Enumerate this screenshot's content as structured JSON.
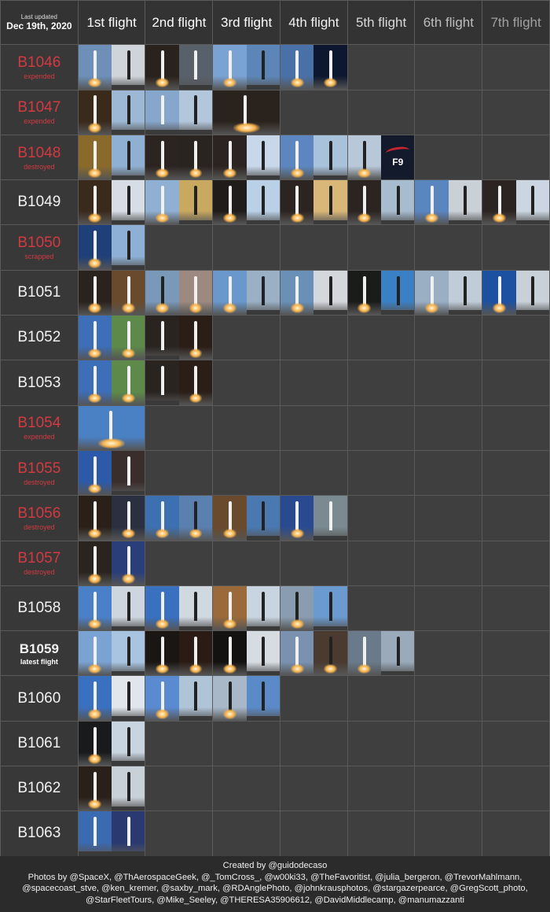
{
  "header": {
    "last_updated_label": "Last updated",
    "last_updated_date": "Dec 19th, 2020",
    "columns": [
      "1st flight",
      "2nd flight",
      "3rd flight",
      "4th flight",
      "5th flight",
      "6th flight",
      "7th flight"
    ],
    "column_colors": [
      "#ffffff",
      "#ffffff",
      "#ffffff",
      "#f0f0f0",
      "#d8d8d8",
      "#bdbdbd",
      "#a0a0a0"
    ]
  },
  "colors": {
    "dead_booster": "#d23a42",
    "active_booster": "#f2f2f2",
    "background": "#2b2b2b",
    "grid_line": "#5a5a5a",
    "empty_cell": "#3f3f3f"
  },
  "boosters": [
    {
      "name": "B1046",
      "status": "expended",
      "state": "dead",
      "flights": [
        [
          "#6d8fb8:light:plume",
          "#cfd4da:dark"
        ],
        [
          "#2a221c:light:plume",
          "#58606a:light"
        ],
        [
          "#7aa2d2:light:plume",
          "#5d86b8:dark"
        ],
        [
          "#4a70a8:light:plume",
          "#0d1830:light:plume"
        ]
      ]
    },
    {
      "name": "B1047",
      "status": "expended",
      "state": "dead",
      "flights": [
        [
          "#3a2a1c:light:plume",
          "#9db8d4:dark"
        ],
        [
          "#86a6cc:light",
          "#b3c7dc:dark"
        ],
        [
          "#2a221c:light:plume"
        ]
      ]
    },
    {
      "name": "B1048",
      "status": "destroyed",
      "state": "dead",
      "flights": [
        [
          "#8a6a2a:light:plume",
          "#8fb0d2:dark"
        ],
        [
          "#2c2420:light:plume",
          "#2a2420:light:plume"
        ],
        [
          "#2c2420:light:plume",
          "#c8d8ea:dark"
        ],
        [
          "#5d86c0:light:plume",
          "#a9c2dc:dark"
        ],
        [
          "#b8c8d8:dark:plume",
          "F9"
        ]
      ]
    },
    {
      "name": "B1049",
      "status": "",
      "state": "active",
      "flights": [
        [
          "#3a2a1c:light:plume",
          "#d6dde4:dark"
        ],
        [
          "#8fb0d2:light:plume",
          "#c9a860:dark"
        ],
        [
          "#201c1a:light:plume",
          "#b9d0e6:dark"
        ],
        [
          "#2c2420:light:plume",
          "#d9b778:dark"
        ],
        [
          "#2c2420:light:plume",
          "#a8bcd0:dark"
        ],
        [
          "#5a86c0:light:plume",
          "#c9d0d6:dark"
        ],
        [
          "#2c2420:light:plume",
          "#cbd6e2:dark"
        ]
      ]
    },
    {
      "name": "B1050",
      "status": "scrapped",
      "state": "dead",
      "flights": [
        [
          "#1f3f78:light:plume",
          "#8eb0d4:dark"
        ]
      ]
    },
    {
      "name": "B1051",
      "status": "",
      "state": "active",
      "flights": [
        [
          "#2a221c:light:plume",
          "#6a4a2c:light:plume"
        ],
        [
          "#7a98b8:dark:plume",
          "#9c8a80:light:plume"
        ],
        [
          "#6a98cc:light:plume",
          "#9ab0c4:dark"
        ],
        [
          "#6a90b8:light:plume",
          "#d4d8dc:dark"
        ],
        [
          "#1a1c1a:light:plume",
          "#3a80c4:dark"
        ],
        [
          "#9aaec4:light:plume",
          "#c0ccd8:dark"
        ],
        [
          "#1c50a0:light:plume",
          "#c8d0d8:dark"
        ]
      ]
    },
    {
      "name": "B1052",
      "status": "",
      "state": "active",
      "flights": [
        [
          "#3d6eb8:light:plume",
          "#5d8a4a:light:plume"
        ],
        [
          "#2a2420:light",
          "#2a1e16:light:plume"
        ]
      ]
    },
    {
      "name": "B1053",
      "status": "",
      "state": "active",
      "flights": [
        [
          "#3d6eb8:light:plume",
          "#5d8a4a:light:plume"
        ],
        [
          "#2a2420:light",
          "#2a1e16:light:plume"
        ]
      ]
    },
    {
      "name": "B1054",
      "status": "expended",
      "state": "dead",
      "flights": [
        [
          "#4a80c4:light:plume"
        ]
      ]
    },
    {
      "name": "B1055",
      "status": "destroyed",
      "state": "dead",
      "flights": [
        [
          "#2d5aa8:light:plume",
          "#3a2e2c:light"
        ]
      ]
    },
    {
      "name": "B1056",
      "status": "destroyed",
      "state": "dead",
      "flights": [
        [
          "#2a2018:light:plume",
          "#2a3040:light:plume"
        ],
        [
          "#3d70b0:light:plume",
          "#5a80b0:dark:plume"
        ],
        [
          "#6a4a2c:light:plume",
          "#4a78b0:dark"
        ],
        [
          "#2a4a90:light:plume",
          "#7a8a90:light"
        ]
      ]
    },
    {
      "name": "B1057",
      "status": "destroyed",
      "state": "dead",
      "flights": [
        [
          "#2a241e:light:plume",
          "#2a3e7a:light:plume"
        ]
      ]
    },
    {
      "name": "B1058",
      "status": "",
      "state": "active",
      "flights": [
        [
          "#4a80c8:light:plume",
          "#cdd6de:dark"
        ],
        [
          "#3a70c0:light:plume",
          "#d0d8e0:dark"
        ],
        [
          "#9a6a3a:light:plume",
          "#c8d4e0:dark"
        ],
        [
          "#8a9cb0:dark:plume",
          "#6a9ad0:dark"
        ]
      ]
    },
    {
      "name": "B1059",
      "status": "latest flight",
      "state": "latest",
      "flights": [
        [
          "#7aa2d2:light:plume",
          "#a9c4e0:dark"
        ],
        [
          "#1a1614:light:plume",
          "#2a1c14:light:plume"
        ],
        [
          "#141210:light:plume",
          "#d6dce2:dark"
        ],
        [
          "#7a92b0:light:plume",
          "#4a3a30:dark:plume"
        ],
        [
          "#6a7a8a:light:plume",
          "#9aaabb:dark"
        ]
      ]
    },
    {
      "name": "B1060",
      "status": "",
      "state": "active",
      "flights": [
        [
          "#3a70c0:light:plume",
          "#e0e6ec:dark"
        ],
        [
          "#5a8ad0:light:plume",
          "#b0c4d8:dark"
        ],
        [
          "#a8b8c8:dark:plume",
          "#5a8ac8:dark"
        ]
      ]
    },
    {
      "name": "B1061",
      "status": "",
      "state": "active",
      "flights": [
        [
          "#181a1c:light:plume",
          "#c8d4e0:dark"
        ]
      ]
    },
    {
      "name": "B1062",
      "status": "",
      "state": "active",
      "flights": [
        [
          "#2a201a:light:plume",
          "#c8d0d8:dark"
        ]
      ]
    },
    {
      "name": "B1063",
      "status": "",
      "state": "active",
      "flights": [
        [
          "#3a6ab0:light",
          "#2a3a70:light"
        ]
      ]
    }
  ],
  "footer": {
    "created_by": "Created by @guidodecaso",
    "photos_by": "Photos by @SpaceX, @ThAerospaceGeek, @_TomCross_, @w00ki33, @TheFavoritist, @julia_bergeron, @TrevorMahlmann, @spacecoast_stve, @ken_kremer, @saxby_mark, @RDAnglePhoto, @johnkrausphotos, @stargazerpearce, @GregScott_photo, @StarFleetTours, @Mike_Seeley, @THERESA35906612, @DavidMiddlecamp, @manumazzanti"
  }
}
